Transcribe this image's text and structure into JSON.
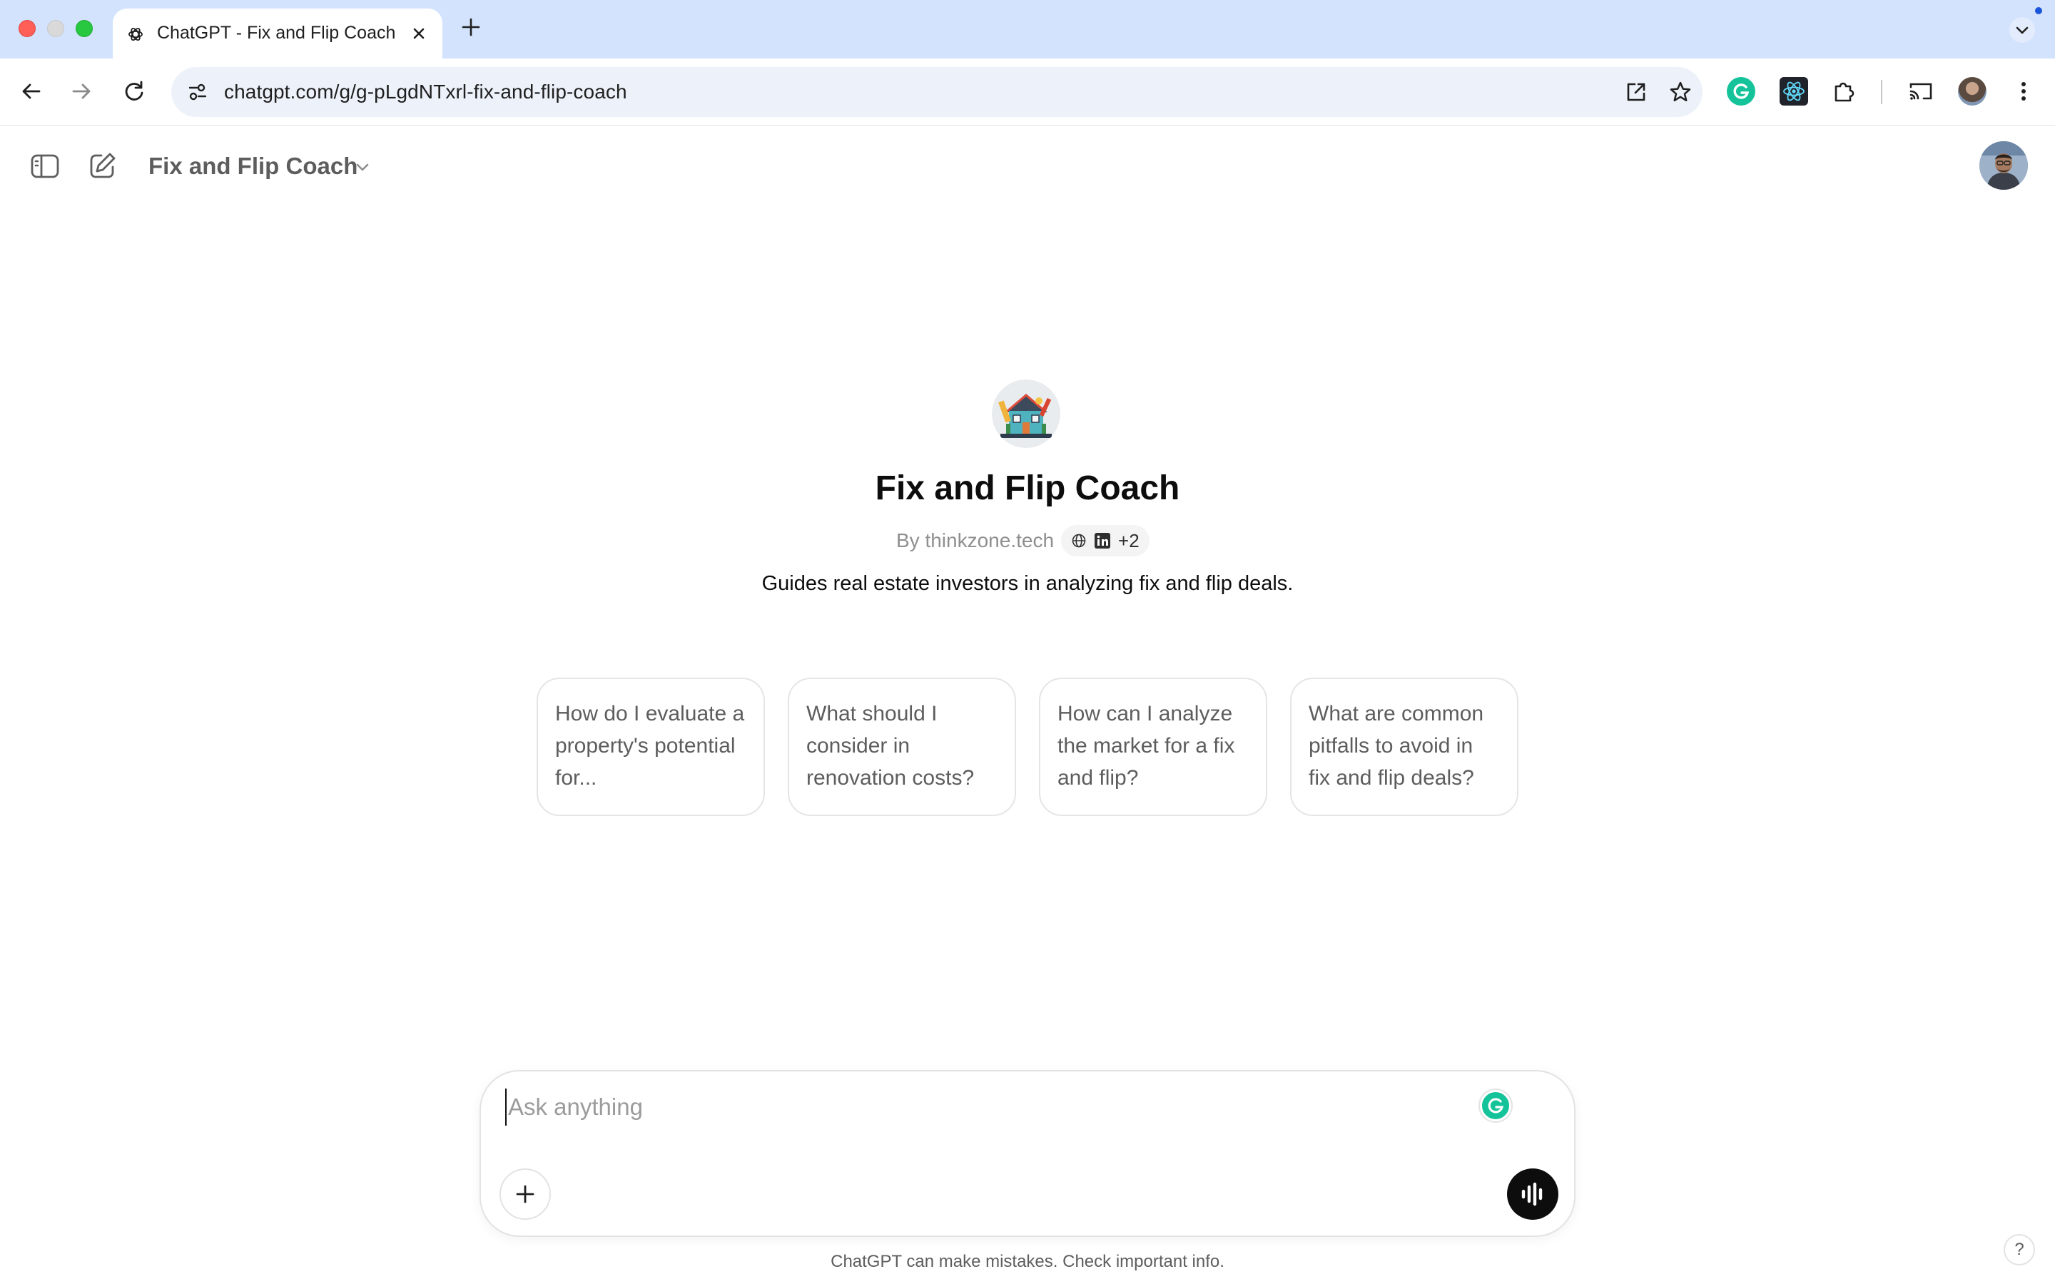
{
  "browser": {
    "tab_title": "ChatGPT - Fix and Flip Coach",
    "url": "chatgpt.com/g/g-pLgdNTxrl-fix-and-flip-coach",
    "icons": [
      "chatgpt-favicon-icon",
      "close-icon",
      "plus-icon",
      "back-arrow-icon",
      "forward-arrow-icon",
      "reload-icon",
      "site-info-icon",
      "open-in-app-icon",
      "star-icon",
      "grammarly-extension-icon",
      "react-devtools-extension-icon",
      "puzzle-extensions-icon",
      "cast-icon",
      "profile-avatar",
      "more-vertical-icon",
      "chevron-down-icon"
    ]
  },
  "header": {
    "gpt_name": "Fix and Flip Coach",
    "icons": [
      "sidebar-toggle-icon",
      "new-chat-icon",
      "chevron-down-icon",
      "user-avatar"
    ]
  },
  "hero": {
    "title": "Fix and Flip Coach",
    "author": "By thinkzone.tech",
    "capabilities_more": "+2",
    "description": "Guides real estate investors in analyzing fix and flip deals."
  },
  "starters": [
    {
      "text": "How do I evaluate a property's potential for..."
    },
    {
      "text": "What should I consider in renovation costs?"
    },
    {
      "text": "How can I analyze the market for a fix and flip?"
    },
    {
      "text": "What are common pitfalls to avoid in fix and flip deals?"
    }
  ],
  "composer": {
    "placeholder": "Ask anything",
    "value": ""
  },
  "footer": {
    "disclaimer": "ChatGPT can make mistakes. Check important info.",
    "help": "?"
  },
  "colors": {
    "tabstrip_bg": "#d3e3fd",
    "omnibox_bg": "#edf2fa",
    "text_primary": "#0d0d0d",
    "text_secondary": "#5d5d5d",
    "grammarly_green": "#15c39a",
    "voice_button": "#0d0d0d"
  }
}
